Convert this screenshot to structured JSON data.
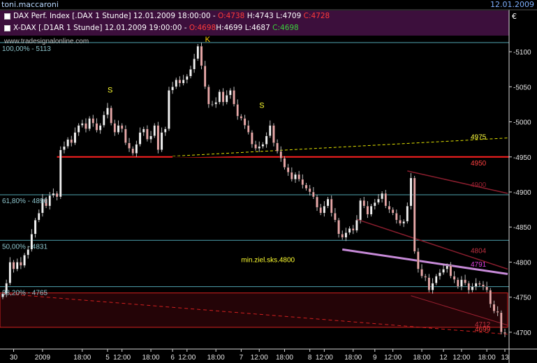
{
  "header": {
    "user": "toni.maccaroni",
    "date": "12.01.2009"
  },
  "legend": {
    "row1": {
      "name": "DAX Perf. Index [.DAX  1 Stunde] 12.01.2009 18:00:00",
      "o": "O:4738",
      "h": "H:4743",
      "l": "L:4709",
      "c": "C:4728"
    },
    "row2": {
      "name": "X-DAX [.D1AR  1 Stunde] 12.01.2009 19:00:00",
      "o": "O:4698",
      "h": "H:4699",
      "l": "L:4687",
      "c": "C:4698"
    }
  },
  "currency_symbol": "€",
  "watermark": "www.tradesignalonline.com",
  "colors": {
    "background": "#000000",
    "legend_bg": "#3c0f3c",
    "bull": "#f2f2f2",
    "bear": "#e8a8a8",
    "fib": "#4fa3b0",
    "red_line": "#ff2020",
    "yellow_line": "#e6e600",
    "channel": "#8a1e2e",
    "lavender": "#c78ad8",
    "box_fill": "#2a0508"
  },
  "chart_data": {
    "type": "candlestick",
    "y_axis": {
      "ylim": [
        4676,
        5122
      ],
      "ticks": [
        4700,
        4750,
        4800,
        4850,
        4900,
        4950,
        5000,
        5050,
        5100
      ],
      "tick_labels": [
        "4700",
        "4750",
        "4800",
        "4850",
        "4900",
        "4950",
        "5000",
        "5050",
        "5100"
      ],
      "position": "right"
    },
    "x_axis": {
      "bar_count": 140,
      "labels": [
        {
          "bar": 3,
          "text": "30"
        },
        {
          "bar": 11,
          "text": "2009"
        },
        {
          "bar": 22,
          "text": "18:00"
        },
        {
          "bar": 29,
          "text": "5"
        },
        {
          "bar": 33,
          "text": "12:00"
        },
        {
          "bar": 41,
          "text": "18:00"
        },
        {
          "bar": 47,
          "text": "6"
        },
        {
          "bar": 51,
          "text": "12:00"
        },
        {
          "bar": 59,
          "text": "18:00"
        },
        {
          "bar": 66,
          "text": "7"
        },
        {
          "bar": 71,
          "text": "12:00"
        },
        {
          "bar": 78,
          "text": "18:00"
        },
        {
          "bar": 85,
          "text": "8"
        },
        {
          "bar": 89,
          "text": "12:00"
        },
        {
          "bar": 97,
          "text": "18:00"
        },
        {
          "bar": 103,
          "text": "9"
        },
        {
          "bar": 108,
          "text": "12:00"
        },
        {
          "bar": 116,
          "text": "18:00"
        },
        {
          "bar": 122,
          "text": "12"
        },
        {
          "bar": 127,
          "text": "12:00"
        },
        {
          "bar": 134,
          "text": "18:00"
        },
        {
          "bar": 139,
          "text": "13"
        }
      ]
    },
    "candles_close": [
      4755,
      4770,
      4800,
      4790,
      4800,
      4795,
      4810,
      4818,
      4840,
      4860,
      4870,
      4890,
      4880,
      4895,
      4898,
      4893,
      4960,
      4965,
      4975,
      4970,
      4985,
      4995,
      4998,
      4990,
      5005,
      4998,
      4988,
      4995,
      5010,
      5020,
      4998,
      4985,
      4995,
      4990,
      4970,
      4962,
      4955,
      4968,
      4985,
      4990,
      4975,
      4980,
      4995,
      4960,
      4985,
      4990,
      5045,
      5050,
      5060,
      5055,
      5060,
      5065,
      5075,
      5090,
      5108,
      5080,
      5050,
      5025,
      5025,
      5028,
      5043,
      5028,
      5038,
      5045,
      5025,
      5008,
      5005,
      4995,
      4985,
      4968,
      4962,
      4965,
      4968,
      4980,
      4995,
      4970,
      4958,
      4948,
      4935,
      4928,
      4918,
      4925,
      4918,
      4910,
      4905,
      4900,
      4893,
      4878,
      4870,
      4880,
      4890,
      4870,
      4860,
      4840,
      4835,
      4842,
      4848,
      4845,
      4860,
      4888,
      4880,
      4868,
      4880,
      4885,
      4890,
      4898,
      4880,
      4875,
      4870,
      4860,
      4855,
      4858,
      4880,
      4920,
      4815,
      4790,
      4780,
      4778,
      4760,
      4770,
      4780,
      4785,
      4790,
      4795,
      4780,
      4775,
      4765,
      4775,
      4770,
      4760,
      4765,
      4770,
      4768,
      4765,
      4760,
      4740,
      4730,
      4728,
      4700,
      4698
    ],
    "fib_levels": [
      {
        "label": "100,00% - 5113",
        "value": 5113
      },
      {
        "label": "61,80% - 4896",
        "value": 4896
      },
      {
        "label": "50,00% - 4831",
        "value": 4831
      },
      {
        "label": "38,20% - 4765",
        "value": 4765
      }
    ],
    "horizontal_lines": [
      {
        "value": 4950,
        "label": "4950",
        "color": "#ff2020"
      }
    ],
    "trendlines": [
      {
        "name": "yellow-dashed",
        "from": [
          47,
          4951
        ],
        "to": [
          139,
          4977
        ],
        "label": "4975",
        "style": "dashed"
      },
      {
        "name": "black-support",
        "from": [
          47,
          4950
        ],
        "to": [
          78,
          4953
        ],
        "style": "solid"
      },
      {
        "name": "channel-upper",
        "from": [
          112,
          4930
        ],
        "to": [
          139,
          4898
        ],
        "label": "4900",
        "style": "solid"
      },
      {
        "name": "channel-middle",
        "from": [
          98,
          4861
        ],
        "to": [
          139,
          4790
        ],
        "label": "4804",
        "style": "solid"
      },
      {
        "name": "lavender-support",
        "from": [
          94,
          4818
        ],
        "to": [
          139,
          4783
        ],
        "label": "4791",
        "style": "solid"
      },
      {
        "name": "red-dashed-lower",
        "from": [
          0,
          4755
        ],
        "to": [
          139,
          4697
        ],
        "style": "dashed"
      },
      {
        "name": "box-channel",
        "from": [
          113,
          4752
        ],
        "to": [
          139,
          4710
        ],
        "style": "solid"
      }
    ],
    "target_box": {
      "x_from": 0,
      "x_to": 139,
      "y_from": 4707,
      "y_to": 4756,
      "label": "4712",
      "label2": "4699"
    },
    "annotations": [
      {
        "text": "S",
        "x": 29,
        "y": 5042
      },
      {
        "text": "S",
        "x": 71,
        "y": 5020
      },
      {
        "text": "K",
        "x": 56,
        "y": 5114
      },
      {
        "text": "min.ziel.sks.4800",
        "x": 66,
        "y": 4800
      }
    ]
  }
}
